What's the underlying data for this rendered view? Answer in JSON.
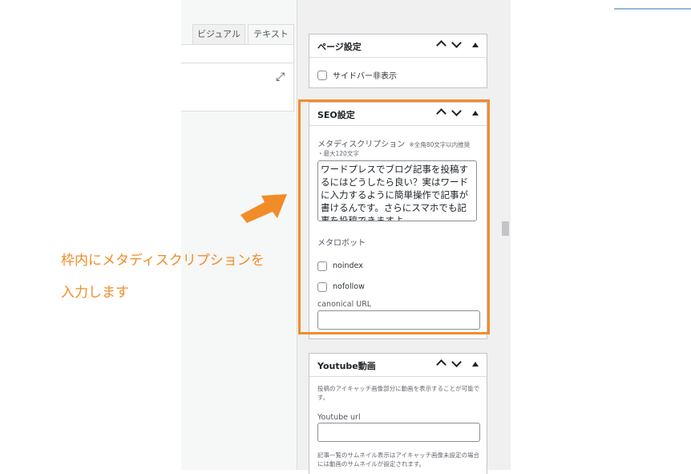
{
  "editor": {
    "tab_visual": "ビジュアル",
    "tab_text": "テキスト"
  },
  "page_settings": {
    "title": "ページ設定",
    "sidebar_hide_label": "サイドバー非表示"
  },
  "seo": {
    "title": "SEO設定",
    "meta_description_label": "メタディスクリプション",
    "meta_description_hint": "※全角80文字以内推奨",
    "meta_description_max": "・最大120文字",
    "meta_description_value": "ワードプレスでブログ記事を投稿するにはどうしたら良い？実はワードに入力するように簡単操作で記事が書けるんです。さらにスマホでも記事を投稿できますよ。",
    "meta_robots_label": "メタロボット",
    "noindex_label": "noindex",
    "nofollow_label": "nofollow",
    "canonical_label": "canonical URL",
    "canonical_value": ""
  },
  "youtube": {
    "title": "Youtube動画",
    "desc1": "投稿のアイキャッチ画像部分に動画を表示することが可能です。",
    "url_label": "Youtube url",
    "url_value": "",
    "desc2": "記事一覧のサムネイル表示はアイキャッチ画像未設定の場合には動画のサムネイルが設定されます。"
  },
  "annotation": {
    "line1": "枠内にメタディスクリプションを",
    "line2": "入力します"
  },
  "colors": {
    "highlight": "#f28c28",
    "admin_bar": "#1d2327"
  }
}
